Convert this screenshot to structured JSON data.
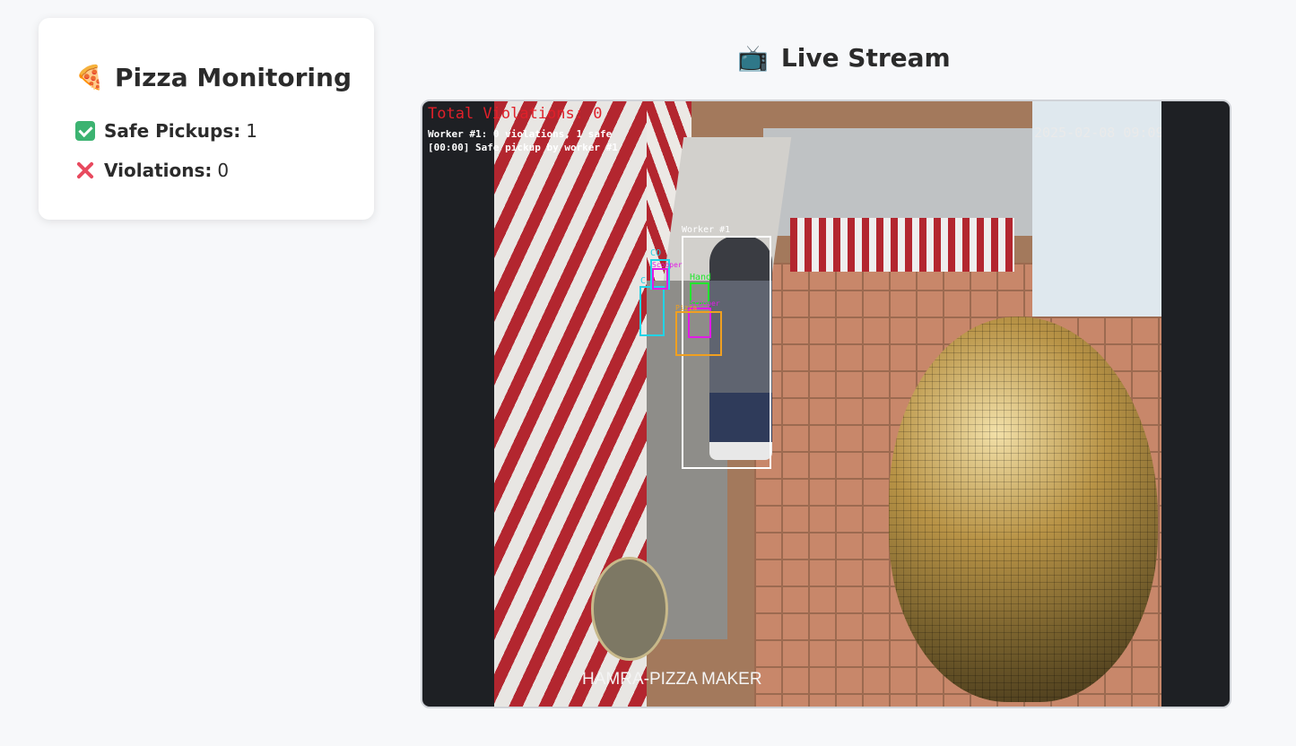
{
  "sidebar": {
    "title": "Pizza Monitoring",
    "title_icon": "pizza-icon",
    "stats": {
      "safe_label": "Safe Pickups:",
      "safe_value": "1",
      "safe_icon": "check-mark-icon",
      "violations_label": "Violations:",
      "violations_value": "0",
      "violations_icon": "cross-mark-icon"
    }
  },
  "stream": {
    "title": "Live Stream",
    "title_icon": "television-icon",
    "overlay": {
      "total_violations": "Total Violations: 0",
      "worker_summary": "Worker #1: 0 violations, 1 safe",
      "event_log": "[00:00] Safe pickup by worker #1",
      "timestamp": "2025-02-08 09:09:05 PM",
      "brand": "HAMRA-PIZZA MAKER",
      "labels": {
        "worker": "Worker #1",
        "hand": "Hand",
        "co": "CO",
        "c": "C",
        "scooper": "Scooper",
        "scooper2": "Scooper",
        "pizza": "Pizza"
      }
    }
  },
  "colors": {
    "background": "#f7f8fa",
    "card": "#ffffff",
    "violation_text": "#e0202a",
    "safe_check": "#3cb371",
    "cross": "#e84a5f"
  }
}
